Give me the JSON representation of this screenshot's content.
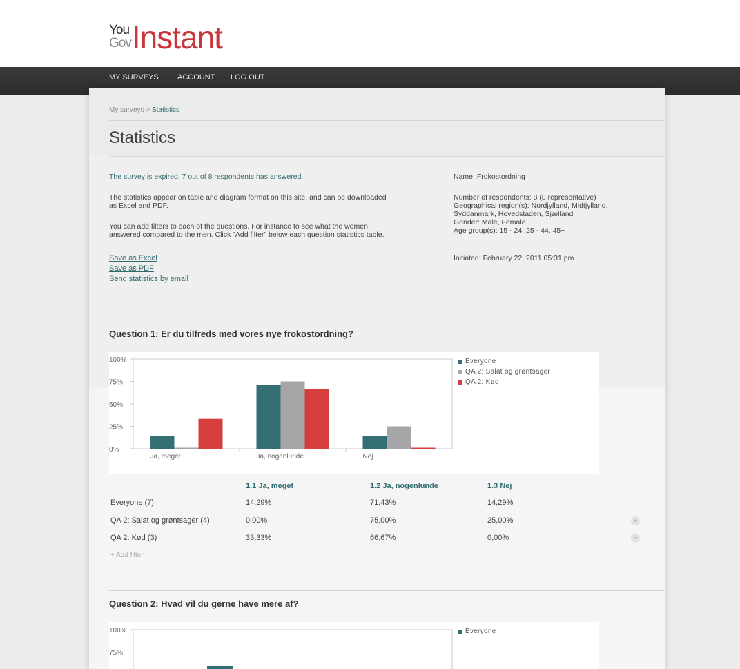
{
  "brand": {
    "logo_you": "You",
    "logo_gov": "Gov",
    "logo_instant": "Instant",
    "accent_color": "#c9353a"
  },
  "nav": {
    "items": [
      "MY SURVEYS",
      "ACCOUNT",
      "LOG OUT"
    ]
  },
  "breadcrumb": {
    "parent": "My surveys",
    "separator": " > ",
    "current": "Statistics"
  },
  "page_title": "Statistics",
  "info": {
    "status": "The survey is expired. 7 out of 8 respondents has answered.",
    "para1_line1": "The statistics appear on table and diagram format on this site, and can be downloaded",
    "para1_line2": "as Excel and PDF.",
    "para2_line1": "You can add filters to each of the questions. For instance to see what the women",
    "para2_line2": "answered compared to the men. Click \"Add filter\" below each question statistics table.",
    "links": [
      "Save as Excel",
      "Save as PDF",
      "Send statistics by email"
    ]
  },
  "survey_meta": {
    "name": "Name: Frokostordning",
    "respondents": "Number of respondents: 8 (8 representative)",
    "region_line1": "Geographical region(s): Nordjylland, Midtjylland,",
    "region_line2": "Syddanmark, Hovedstaden, Sjælland",
    "gender": "Gender: Male, Female",
    "age": "Age group(s): 15 - 24, 25 - 44, 45+",
    "initiated": "Initiated: February 22, 2011 05:31 pm"
  },
  "question1": {
    "title": "Question 1: Er du tilfreds med vores nye frokostordning?",
    "table": {
      "headers": [
        "1.1 Ja, meget",
        "1.2 Ja, nogenlunde",
        "1.3 Nej"
      ],
      "rows": [
        {
          "label": "Everyone (7)",
          "cells": [
            "14,29%",
            "71,43%",
            "14,29%"
          ]
        },
        {
          "label": "QA 2: Salat og grøntsager (4)",
          "cells": [
            "0,00%",
            "75,00%",
            "25,00%"
          ]
        },
        {
          "label": "QA 2: Kød (3)",
          "cells": [
            "33,33%",
            "66,67%",
            "0,00%"
          ]
        }
      ],
      "add_filter": "+ Add filter",
      "remove_symbol": "÷"
    }
  },
  "question2": {
    "title": "Question 2: Hvad vil du gerne have mere af?"
  },
  "chart_data": [
    {
      "type": "bar",
      "categories": [
        "Ja, meget",
        "Ja, nogenlunde",
        "Nej"
      ],
      "series": [
        {
          "name": "Everyone",
          "values": [
            14.29,
            71.43,
            14.29
          ],
          "color": "#346f73"
        },
        {
          "name": "QA 2: Salat og grøntsager",
          "values": [
            0,
            75,
            25
          ],
          "color": "#a6a6a9"
        },
        {
          "name": "QA 2: Kød",
          "values": [
            33.33,
            66.67,
            0
          ],
          "color": "#d43f3d"
        }
      ],
      "yticks": [
        "0%",
        "25%",
        "50%",
        "75%",
        "100%"
      ],
      "ylim": [
        0,
        100
      ],
      "legend_position": "right",
      "grid": false
    },
    {
      "type": "bar",
      "categories": [],
      "series": [
        {
          "name": "Everyone",
          "values": [],
          "color": "#346f73"
        }
      ],
      "yticks": [
        "75%",
        "100%"
      ],
      "ylim": [
        0,
        100
      ],
      "legend_position": "right",
      "grid": false
    }
  ]
}
